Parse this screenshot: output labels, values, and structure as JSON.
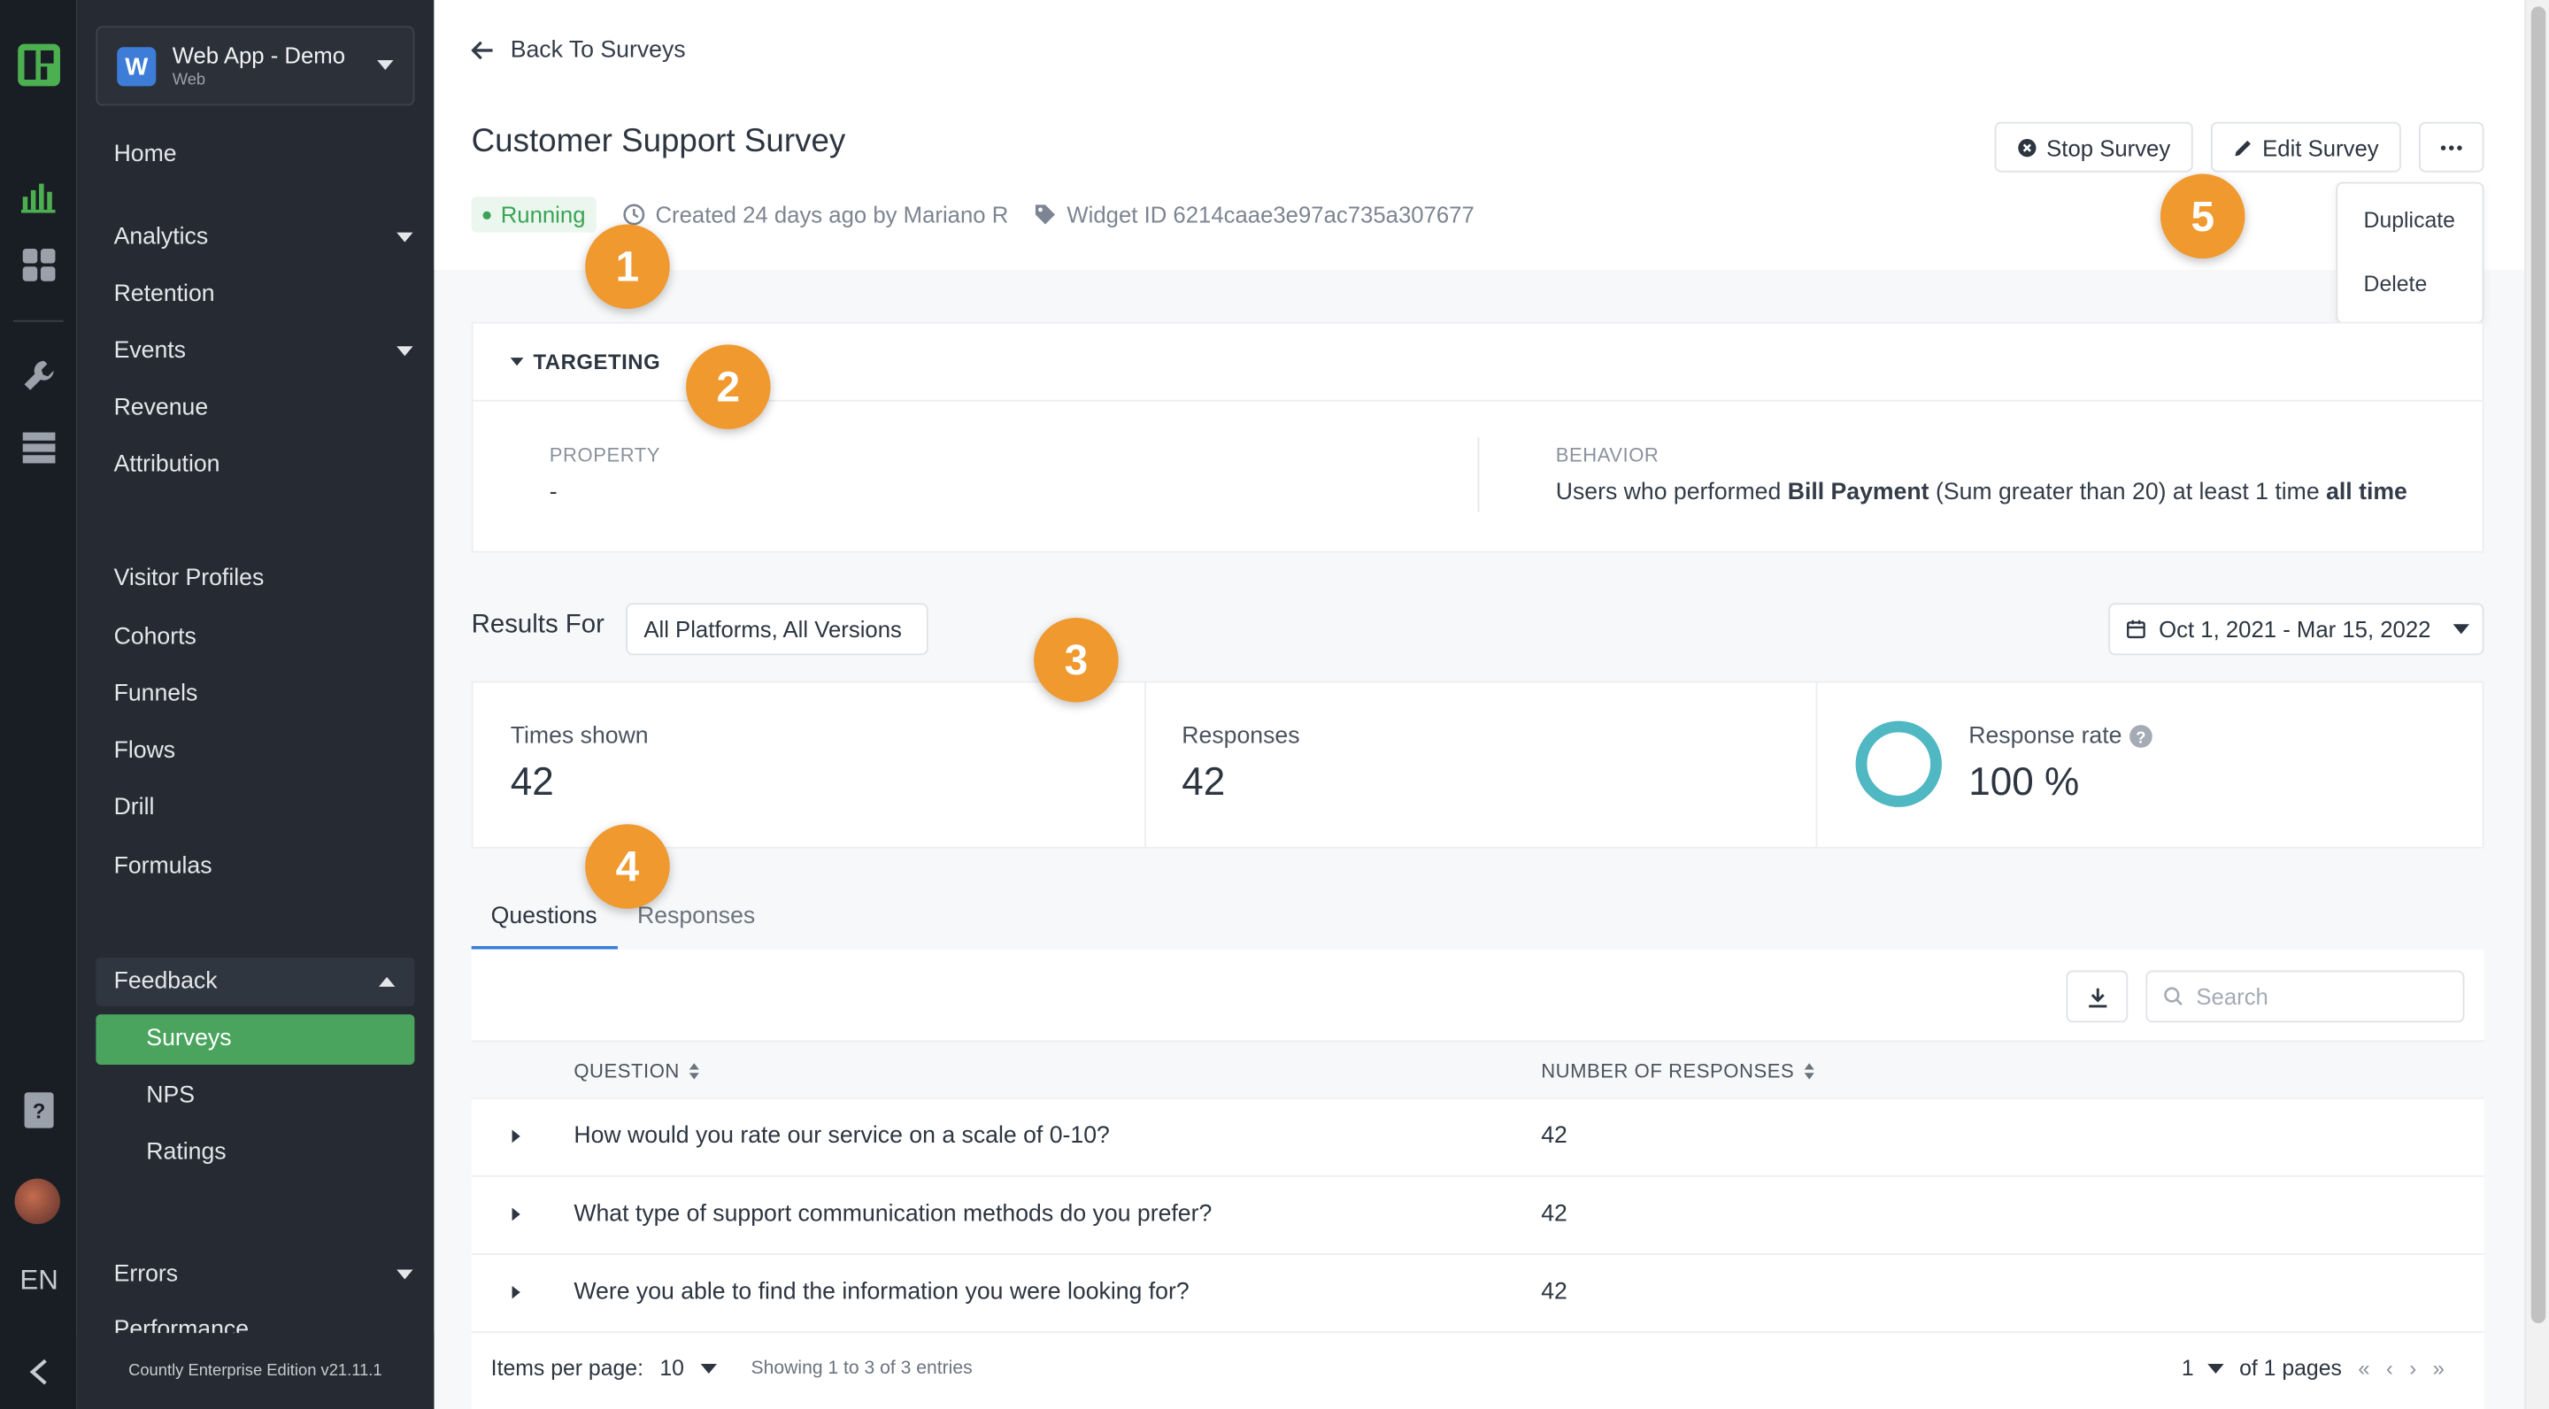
{
  "app": {
    "name": "Web App - Demo",
    "type": "Web",
    "badge": "W",
    "version": "Countly Enterprise Edition v21.11.1",
    "language": "EN"
  },
  "sidebar": {
    "home": "Home",
    "analytics": "Analytics",
    "retention": "Retention",
    "events": "Events",
    "revenue": "Revenue",
    "attribution": "Attribution",
    "visitor_profiles": "Visitor Profiles",
    "cohorts": "Cohorts",
    "funnels": "Funnels",
    "flows": "Flows",
    "drill": "Drill",
    "formulas": "Formulas",
    "feedback": "Feedback",
    "surveys": "Surveys",
    "nps": "NPS",
    "ratings": "Ratings",
    "errors": "Errors",
    "performance": "Performance"
  },
  "header": {
    "back_label": "Back To Surveys",
    "title": "Customer Support Survey",
    "status": "Running",
    "created": "Created 24 days ago by Mariano R",
    "widget_id": "Widget ID 6214caae3e97ac735a307677",
    "stop_label": "Stop Survey",
    "edit_label": "Edit Survey",
    "more_menu": [
      "Duplicate",
      "Delete"
    ]
  },
  "targeting": {
    "header": "TARGETING",
    "property_label": "PROPERTY",
    "property_value": "-",
    "behavior_label": "BEHAVIOR",
    "behavior_prefix": "Users who performed ",
    "behavior_event": "Bill Payment",
    "behavior_middle": " (Sum greater than 20) at least 1 time ",
    "behavior_period": "all time"
  },
  "results": {
    "label": "Results For",
    "platform_filter": "All Platforms, All Versions",
    "date_range": "Oct 1, 2021 - Mar 15, 2022"
  },
  "stats": {
    "times_shown_label": "Times shown",
    "times_shown": "42",
    "responses_label": "Responses",
    "responses": "42",
    "response_rate_label": "Response rate",
    "response_rate": "100 %",
    "response_rate_fraction": 1.0
  },
  "tabs": [
    "Questions",
    "Responses"
  ],
  "table": {
    "search_placeholder": "Search",
    "columns": [
      "QUESTION",
      "NUMBER OF RESPONSES"
    ],
    "rows": [
      {
        "question": "How would you rate our service on a scale of 0-10?",
        "responses": "42"
      },
      {
        "question": "What type of support communication methods do you prefer?",
        "responses": "42"
      },
      {
        "question": "Were you able to find the information you were looking for?",
        "responses": "42"
      }
    ],
    "items_per_page_label": "Items per page:",
    "items_per_page": "10",
    "showing": "Showing 1 to 3 of 3 entries",
    "page": "1",
    "of_pages": "of 1 pages"
  },
  "callouts": [
    "1",
    "2",
    "3",
    "4",
    "5"
  ],
  "colors": {
    "accent_green": "#4aa45e",
    "accent_blue": "#3d7dd8",
    "callout_orange": "#f0992e",
    "donut_teal": "#4fb8c3",
    "sidebar_bg": "#262b33"
  }
}
